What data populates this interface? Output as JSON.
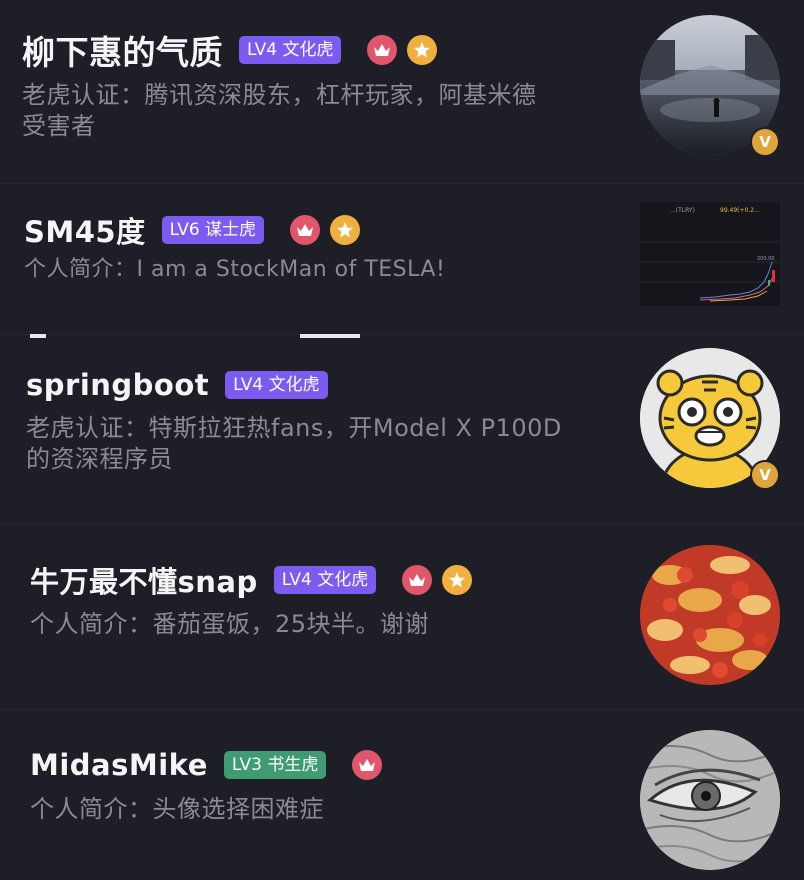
{
  "users": [
    {
      "name": "柳下惠的气质",
      "level": "LV4 文化虎",
      "desc": "老虎认证：腾讯资深股东，杠杆玩家，阿基米德受害者",
      "desc_line1": "老虎认证：腾讯资深股东，杠杆玩家，阿基米德",
      "desc_line2": "受害者",
      "verified": "V"
    },
    {
      "name": "SM45度",
      "level": "LV6 谋士虎",
      "desc": "个人简介：I am a StockMan of TESLA!"
    },
    {
      "name": "springboot",
      "level": "LV4 文化虎",
      "desc_line1": "老虎认证：特斯拉狂热fans，开Model X P100D",
      "desc_line2": "的资深程序员",
      "verified": "V"
    },
    {
      "name": "牛万最不懂snap",
      "level": "LV4 文化虎",
      "desc": "个人简介：番茄蛋饭，25块半。谢谢"
    },
    {
      "name": "MidasMike",
      "level": "LV3 书生虎",
      "desc": "个人简介：头像选择困难症"
    }
  ],
  "chart_thumb": {
    "ticker": "...(TLRY)",
    "price": "99.49(+0.2...",
    "axis_value": "200.00"
  },
  "colors": {
    "background": "#1e1e26",
    "badge_purple": "#7c5cf0",
    "badge_green": "#3f9c72",
    "crown": "#e0566a",
    "star": "#f0b040",
    "desc": "#8a8a96"
  }
}
